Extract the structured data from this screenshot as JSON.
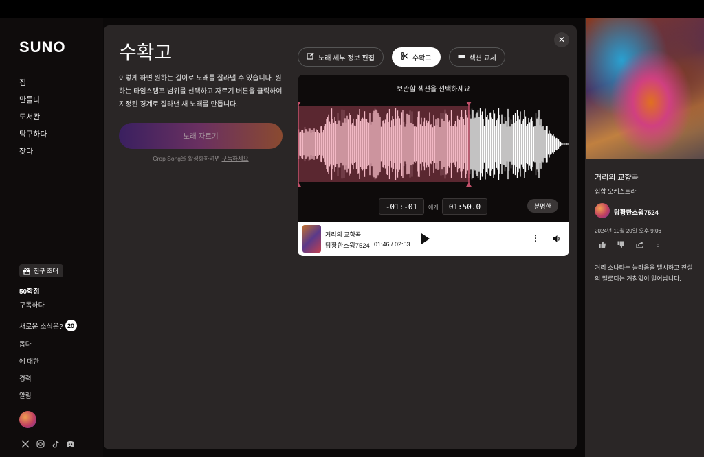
{
  "app": {
    "logo": "SUNO"
  },
  "sidebar": {
    "nav": [
      "집",
      "만들다",
      "도서관",
      "탐구하다",
      "찾다"
    ],
    "invite_label": "친구 초대",
    "credits": "50학점",
    "subscribe": "구독하다",
    "news_label": "새로운 소식은?",
    "news_count": "20",
    "sub_nav": [
      "돕다",
      "에 대한",
      "경력",
      "알림"
    ],
    "socials": [
      "x-icon",
      "instagram-icon",
      "tiktok-icon",
      "discord-icon"
    ]
  },
  "modal": {
    "title": "수확고",
    "description": "이렇게 하면 원하는 길이로 노래를 잘라낼 수 있습니다. 원하는 타임스탬프 범위를 선택하고 자르기 버튼을 클릭하여 지정된 경계로 잘라낸 새 노래를 만듭니다.",
    "crop_button": "노래 자르기",
    "crop_note_prefix": "Crop Song을 활성화하려면 ",
    "crop_note_link": "구독하세요",
    "tabs": [
      {
        "label": "노래 세부 정보 편집",
        "icon": "edit-icon"
      },
      {
        "label": "수확고",
        "icon": "scissors-icon"
      },
      {
        "label": "섹션 교체",
        "icon": "replace-icon"
      }
    ],
    "waveform": {
      "title": "보관할 섹션을 선택하세요",
      "start_time": "-01:-01",
      "to_label": "에게",
      "end_time": "01:50.0",
      "clear_button": "분명한",
      "selection_fraction": 0.63
    },
    "player": {
      "title": "거리의 교향곡",
      "artist": "당황한스윙7524",
      "time": "01:46 / 02:53"
    }
  },
  "right_panel": {
    "title": "거리의 교향곡",
    "genre": "힙합 오케스트라",
    "artist": "당황한스윙7524",
    "date": "2024년 10월 20일 오후 9:06",
    "description": "거리 소나타는 놀라움을 멜시하고 전설의 멜로디는 거침없이 일어납니다."
  },
  "colors": {
    "accent": "#c2506a",
    "selection": "#5a2730",
    "wave": "#f2b8c4"
  }
}
